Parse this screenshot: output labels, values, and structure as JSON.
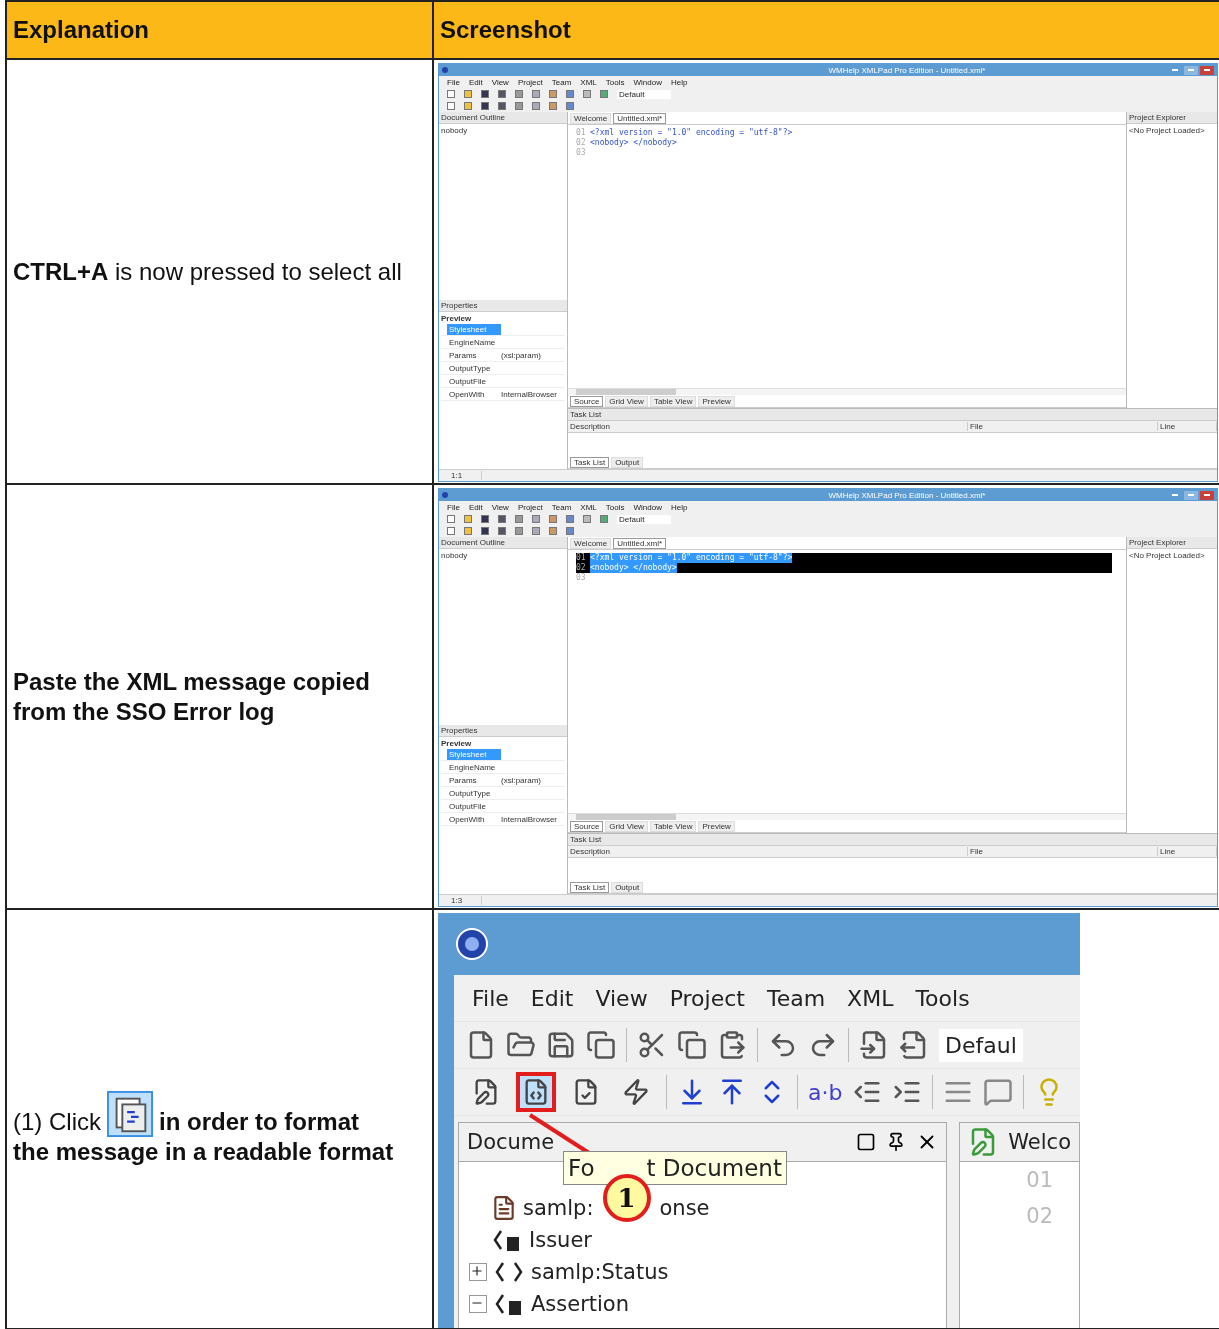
{
  "table": {
    "columns": [
      "Explanation",
      "Screenshot"
    ],
    "rows": [
      {
        "explanation": {
          "kind": "text",
          "text": "**CTRL+A** is now pressed to select all",
          "bold": false
        },
        "screenshot": {
          "kind": "ide_full",
          "title": "WMHelp XMLPad Pro Edition - Untitled.xml*",
          "menu": [
            "File",
            "Edit",
            "View",
            "Project",
            "Team",
            "XML",
            "Tools",
            "Window",
            "Help"
          ],
          "toolbar_field": "Default",
          "outline_title": "Document Outline",
          "outline_items": [
            "nobody"
          ],
          "editor_tabs": [
            {
              "label": "Welcome",
              "selected": false
            },
            {
              "label": "Untitled.xml*",
              "selected": true
            }
          ],
          "code_lines": [
            {
              "number": "01",
              "text": "<?xml version = \"1.0\" encoding = \"utf-8\"?>",
              "selected": false
            },
            {
              "number": "02",
              "text": "<nobody> </nobody>",
              "selected": false
            },
            {
              "number": "03",
              "selected": false
            }
          ],
          "properties_title": "Properties",
          "properties_group": "Preview",
          "properties": [
            {
              "name": "Stylesheet",
              "selected": true
            },
            {
              "name": "EngineName",
              "selected": false
            },
            {
              "name": "Params",
              "value": "(xsl:param)",
              "selected": false
            },
            {
              "name": "OutputType",
              "selected": false
            },
            {
              "name": "OutputFile",
              "selected": false
            },
            {
              "name": "OpenWith",
              "value": "InternalBrowser",
              "selected": false
            }
          ],
          "explorer_title": "Project Explorer",
          "explorer_item": "<No Project Loaded>",
          "view_tabs": [
            {
              "label": "Source",
              "selected": true
            },
            {
              "label": "Grid View",
              "selected": false
            },
            {
              "label": "Table View",
              "selected": false
            },
            {
              "label": "Preview",
              "selected": false
            }
          ],
          "task_title": "Task List",
          "task_columns": [
            "Description",
            "File",
            "Line"
          ],
          "bottom_tabs": [
            {
              "label": "Task List",
              "selected": true
            },
            {
              "label": "Output",
              "selected": false
            }
          ],
          "status": "1:1"
        }
      },
      {
        "explanation": {
          "kind": "text",
          "text": "Paste the XML message copied from the SSO Error log",
          "bold": true
        },
        "screenshot": {
          "kind": "ide_full",
          "title": "WMHelp XMLPad Pro Edition - Untitled.xml*",
          "menu": [
            "File",
            "Edit",
            "View",
            "Project",
            "Team",
            "XML",
            "Tools",
            "Window",
            "Help"
          ],
          "toolbar_field": "Default",
          "outline_title": "Document Outline",
          "outline_items": [
            "nobody"
          ],
          "editor_tabs": [
            {
              "label": "Welcome",
              "selected": false
            },
            {
              "label": "Untitled.xml*",
              "selected": true
            }
          ],
          "code_lines": [
            {
              "number": "01",
              "text": "<?xml version = \"1.0\" encoding = \"utf-8\"?>",
              "selected": true
            },
            {
              "number": "02",
              "text": "<nobody> </nobody>",
              "selected": true
            },
            {
              "number": "03",
              "selected": false
            }
          ],
          "properties_title": "Properties",
          "properties_group": "Preview",
          "properties": [
            {
              "name": "Stylesheet",
              "selected": true
            },
            {
              "name": "EngineName",
              "selected": false
            },
            {
              "name": "Params",
              "value": "(xsl:param)",
              "selected": false
            },
            {
              "name": "OutputType",
              "selected": false
            },
            {
              "name": "OutputFile",
              "selected": false
            },
            {
              "name": "OpenWith",
              "value": "InternalBrowser",
              "selected": false
            }
          ],
          "explorer_title": "Project Explorer",
          "explorer_item": "<No Project Loaded>",
          "view_tabs": [
            {
              "label": "Source",
              "selected": true
            },
            {
              "label": "Grid View",
              "selected": false
            },
            {
              "label": "Table View",
              "selected": false
            },
            {
              "label": "Preview",
              "selected": false
            }
          ],
          "task_title": "Task List",
          "task_columns": [
            "Description",
            "File",
            "Line"
          ],
          "bottom_tabs": [
            {
              "label": "Task List",
              "selected": true
            },
            {
              "label": "Output",
              "selected": false
            }
          ],
          "status": "1:3"
        }
      },
      {
        "explanation": {
          "kind": "icon_instruction",
          "before": "(1) Click",
          "after": "in order to format",
          "after_2": "the message in a readable format",
          "bold": true
        },
        "screenshot": {
          "kind": "ide_zoom",
          "menu": [
            "File",
            "Edit",
            "View",
            "Project",
            "Team",
            "XML",
            "Tools"
          ],
          "toolbar_field": "Defaul",
          "format_buttons": [
            {
              "highlighted": false
            },
            {
              "highlighted": true
            },
            {
              "highlighted": false
            },
            {
              "highlighted": false
            }
          ],
          "format_label": "a·b",
          "panel_title": "Docume",
          "tooltip": "Fo",
          "tooltip_end": "t Document",
          "callout": "1",
          "tree": [
            {
              "label": "samlp:",
              "label_end": "onse",
              "children": [
                {
                  "label": "Issuer",
                  "kind": "attribute"
                },
                {
                  "label": "samlp:Status",
                  "kind": "element",
                  "expanded": false
                },
                {
                  "label": "Assertion",
                  "kind": "attribute",
                  "expanded": true
                }
              ]
            }
          ],
          "editor_tab": "Welco",
          "line_numbers": [
            "01",
            "02"
          ]
        }
      }
    ]
  }
}
